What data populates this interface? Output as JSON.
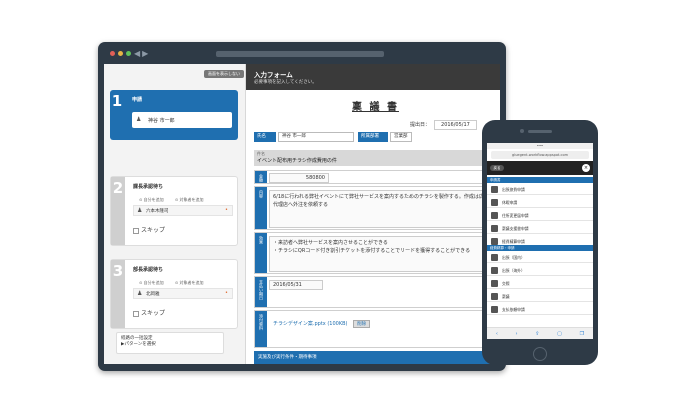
{
  "laptop": {
    "left_panel": {
      "hide_button": "画面を表示しない",
      "step1": {
        "num": "1",
        "title": "申請",
        "user": "神谷 市一郎"
      },
      "step2": {
        "num": "2",
        "title": "課長承認待ち",
        "toggle_a": "自分を追加",
        "toggle_b": "対象者を追加",
        "user": "六本木隆司",
        "skip": "スキップ"
      },
      "step3": {
        "num": "3",
        "title": "部長承認待ち",
        "toggle_a": "自分を追加",
        "toggle_b": "対象者を追加",
        "user": "北岡雅",
        "skip": "スキップ"
      },
      "bulk_line1": "経路の一括設定",
      "bulk_line2": "▶パターンを選択"
    },
    "form": {
      "title": "入力フォーム",
      "subtitle": "必要事項を記入してください。",
      "doc_title": "稟 議 書",
      "date_label": "提出日：",
      "date_value": "2016/05/17",
      "name_label": "氏名",
      "name_value": "神谷 市一郎",
      "dept_label": "所属部署",
      "dept_value": "営業部",
      "subject_label": "件名",
      "subject_value": "イベント配布用チラシ作成費用の件",
      "amount_label": "金額",
      "amount_value": "580800",
      "purpose_label": "内容",
      "purpose_text": "6/18に行われる弊社イベントにて弊社サービスを案内するためのチラシを製作する。作成は広告代理店へ外注を依頼する",
      "effect_label": "効果",
      "effect_line1": "・来訪者へ弊社サービスを案内させることができる",
      "effect_line2": "・チラシにQRコード付き割引チケットを添付することでリードを獲得することができる",
      "deadline_label": "支払い期日",
      "deadline_value": "2016/05/31",
      "file_label": "添付資料",
      "file_name": "チラシデザイン案.pptx (100KB)",
      "delete_label": "削除",
      "footer": "実施及び実行条件・期待事項"
    }
  },
  "phone": {
    "url": "gluegent-workflow.appspot.com",
    "back": "戻る",
    "close": "×",
    "section1": "申請書",
    "items1": [
      "出張旅費申請",
      "休暇申請",
      "住所変更届申請",
      "稟議支援書申請",
      "経費精算申請"
    ],
    "section2": "経費精算・申請",
    "items2": [
      "出張（国内）",
      "出張（海外）",
      "交際",
      "稟議",
      "支払依頼申請"
    ]
  },
  "colors": {
    "accent": "#1f6fb0",
    "frame": "#2e3a46",
    "dot_red": "#e05f57",
    "dot_yellow": "#e6b345",
    "dot_green": "#5fc25a"
  }
}
